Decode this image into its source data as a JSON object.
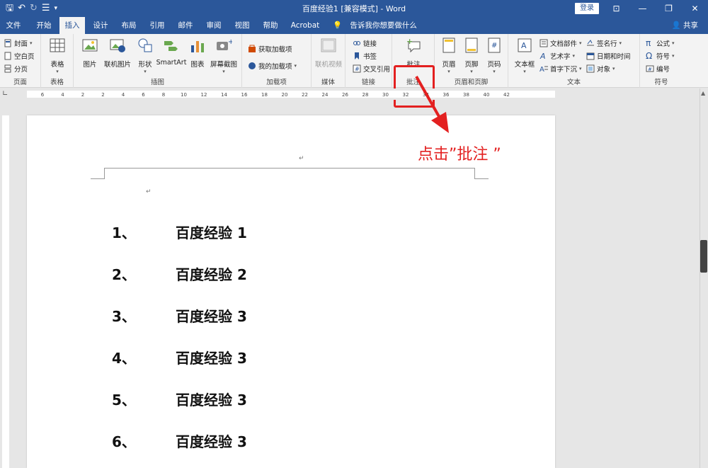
{
  "window": {
    "title": "百度经验1 [兼容模式] - Word",
    "login_label": "登录",
    "controls": [
      "⊡",
      "—",
      "❐",
      "✕"
    ]
  },
  "tabs": [
    {
      "label": "文件",
      "active": false
    },
    {
      "label": "开始",
      "active": false
    },
    {
      "label": "插入",
      "active": true
    },
    {
      "label": "设计",
      "active": false
    },
    {
      "label": "布局",
      "active": false
    },
    {
      "label": "引用",
      "active": false
    },
    {
      "label": "邮件",
      "active": false
    },
    {
      "label": "审阅",
      "active": false
    },
    {
      "label": "视图",
      "active": false
    },
    {
      "label": "帮助",
      "active": false
    },
    {
      "label": "Acrobat",
      "active": false
    }
  ],
  "tell_me": "告诉我你想要做什么",
  "share_label": "共享",
  "ribbon": {
    "pages": {
      "cover": "封面",
      "blank": "空白页",
      "break": "分页",
      "label": "页面"
    },
    "tables": {
      "table": "表格",
      "label": "表格"
    },
    "illustrations": {
      "picture": "图片",
      "online_picture": "联机图片",
      "shapes": "形状",
      "smartart": "SmartArt",
      "chart": "图表",
      "screenshot": "屏幕截图",
      "label": "插图"
    },
    "addins": {
      "get": "获取加载项",
      "my": "我的加载项",
      "label": "加载项"
    },
    "media": {
      "online_video": "联机视频",
      "label": "媒体"
    },
    "links": {
      "link": "链接",
      "bookmark": "书签",
      "crossref": "交叉引用",
      "label": "链接"
    },
    "comments": {
      "comment": "批注",
      "label": "批注"
    },
    "header_footer": {
      "header": "页眉",
      "footer": "页脚",
      "page_number": "页码",
      "label": "页眉和页脚"
    },
    "text": {
      "textbox": "文本框",
      "quick_parts": "文档部件",
      "wordart": "艺术字",
      "dropcap": "首字下沉",
      "signature": "签名行",
      "datetime": "日期和时间",
      "object": "对象",
      "label": "文本"
    },
    "symbols": {
      "equation": "公式",
      "symbol": "符号",
      "number": "编号",
      "label": "符号"
    }
  },
  "ruler_labels": [
    "6",
    "4",
    "2",
    "2",
    "4",
    "6",
    "8",
    "10",
    "12",
    "14",
    "16",
    "18",
    "20",
    "22",
    "24",
    "26",
    "28",
    "30",
    "32",
    "34",
    "36",
    "38",
    "40",
    "42"
  ],
  "document": {
    "items": [
      {
        "num": "1、",
        "text": "百度经验 1"
      },
      {
        "num": "2、",
        "text": "百度经验 2"
      },
      {
        "num": "3、",
        "text": "百度经验 3"
      },
      {
        "num": "4、",
        "text": "百度经验 3"
      },
      {
        "num": "5、",
        "text": "百度经验 3"
      },
      {
        "num": "6、",
        "text": "百度经验 3"
      }
    ],
    "pilcrow": "↵"
  },
  "annotation": {
    "text": "点击”批注 ”",
    "color": "#e32020"
  },
  "colors": {
    "brand": "#2b579a",
    "ribbon_bg": "#f3f3f3"
  }
}
